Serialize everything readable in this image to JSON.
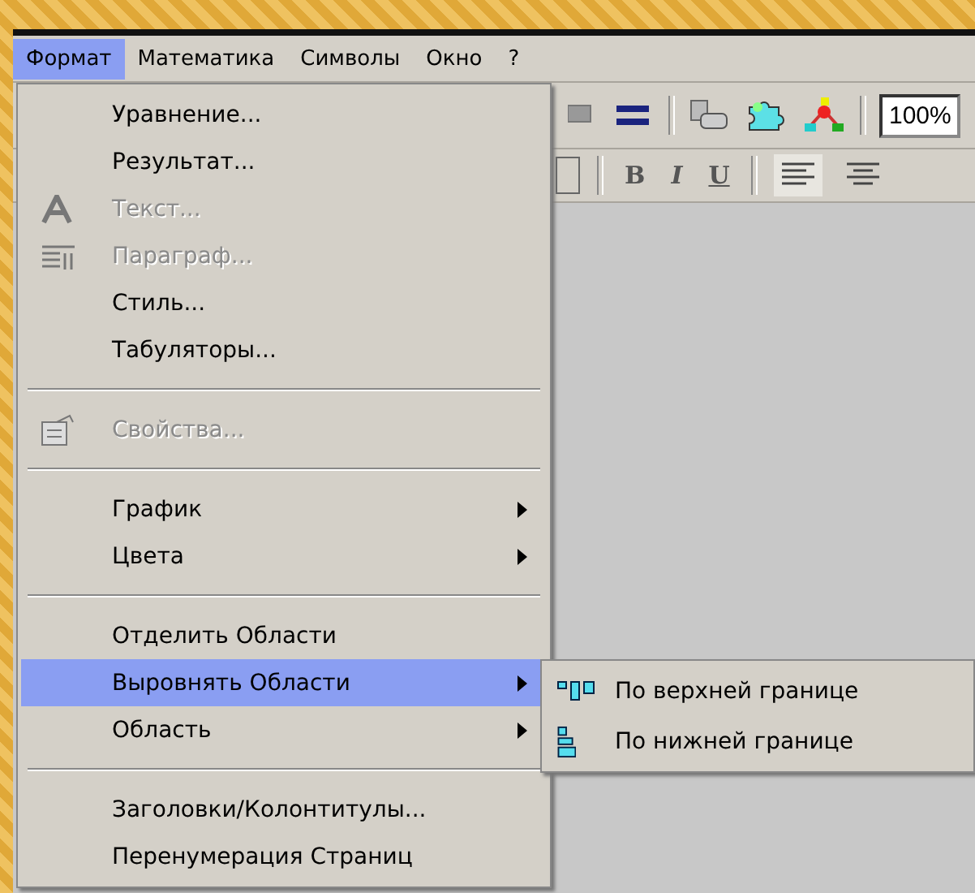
{
  "menubar": [
    {
      "label": "Формат",
      "selected": true
    },
    {
      "label": "Математика",
      "selected": false
    },
    {
      "label": "Символы",
      "selected": false
    },
    {
      "label": "Окно",
      "selected": false
    },
    {
      "label": "?",
      "selected": false
    }
  ],
  "toolbar": {
    "zoom_field": {
      "value": "100%"
    },
    "format_buttons": [
      {
        "label": "B"
      },
      {
        "label": "I"
      },
      {
        "label": "U"
      }
    ],
    "align_buttons": [
      {
        "selected": true
      },
      {
        "selected": false
      }
    ]
  },
  "menu": [
    {
      "kind": "item",
      "label": "Уравнение...",
      "disabled": false,
      "submenu": false,
      "selected": false
    },
    {
      "kind": "item",
      "label": "Результат...",
      "disabled": false,
      "submenu": false,
      "selected": false
    },
    {
      "kind": "item",
      "label": "Текст...",
      "disabled": true,
      "submenu": false,
      "selected": false
    },
    {
      "kind": "item",
      "label": "Параграф...",
      "disabled": true,
      "submenu": false,
      "selected": false
    },
    {
      "kind": "item",
      "label": "Стиль...",
      "disabled": false,
      "submenu": false,
      "selected": false
    },
    {
      "kind": "item",
      "label": "Табуляторы...",
      "disabled": false,
      "submenu": false,
      "selected": false
    },
    {
      "kind": "separator"
    },
    {
      "kind": "item",
      "label": "Свойства...",
      "disabled": true,
      "submenu": false,
      "selected": false
    },
    {
      "kind": "separator"
    },
    {
      "kind": "item",
      "label": "График",
      "disabled": false,
      "submenu": true,
      "selected": false
    },
    {
      "kind": "item",
      "label": "Цвета",
      "disabled": false,
      "submenu": true,
      "selected": false
    },
    {
      "kind": "separator"
    },
    {
      "kind": "item",
      "label": "Отделить Области",
      "disabled": false,
      "submenu": false,
      "selected": false
    },
    {
      "kind": "item",
      "label": "Выровнять Области",
      "disabled": false,
      "submenu": true,
      "selected": true
    },
    {
      "kind": "item",
      "label": "Область",
      "disabled": false,
      "submenu": true,
      "selected": false
    },
    {
      "kind": "separator"
    },
    {
      "kind": "item",
      "label": "Заголовки/Колонтитулы...",
      "disabled": false,
      "submenu": false,
      "selected": false
    },
    {
      "kind": "item",
      "label": "Перенумерация Страниц",
      "disabled": false,
      "submenu": false,
      "selected": false
    }
  ],
  "submenu": [
    {
      "label": "По верхней границе"
    },
    {
      "label": "По нижней границе"
    }
  ]
}
